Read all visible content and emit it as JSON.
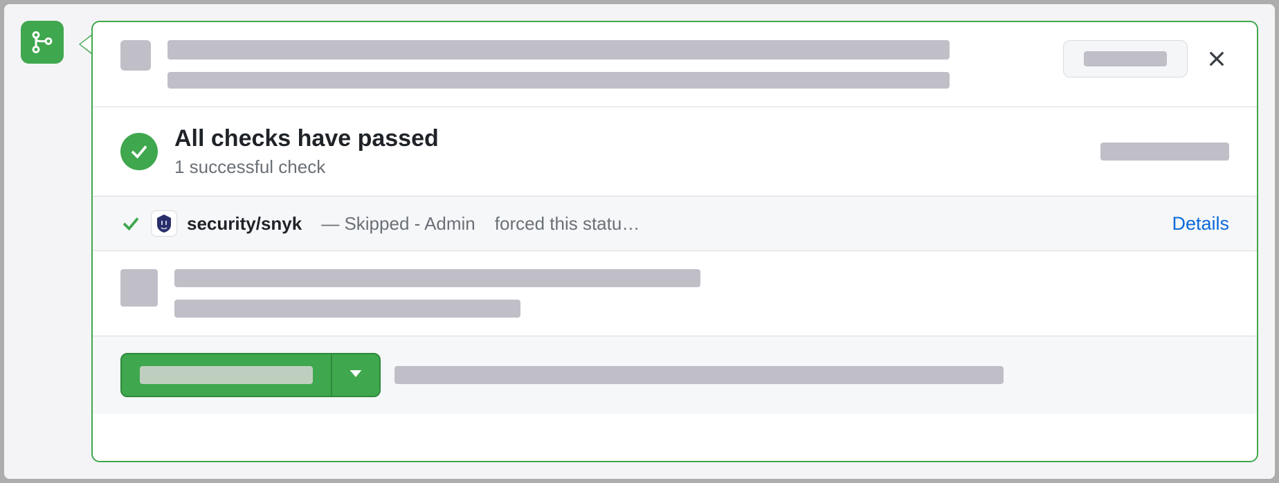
{
  "colors": {
    "success": "#3fa74d",
    "link": "#0a69da",
    "muted": "#6a7076",
    "placeholder": "#c0bfc8"
  },
  "merge_icon": "git-merge-icon",
  "header": {
    "close_label": "Close"
  },
  "status": {
    "title": "All checks have passed",
    "subtitle": "1 successful check"
  },
  "checks": [
    {
      "icon": "check-icon",
      "app_icon": "snyk-app-icon",
      "name": "security/snyk",
      "message_prefix": "— Skipped - Admin",
      "message_suffix": "forced this statu…",
      "details_label": "Details"
    }
  ],
  "footer": {
    "primary_button_icon": "caret-down-icon"
  }
}
